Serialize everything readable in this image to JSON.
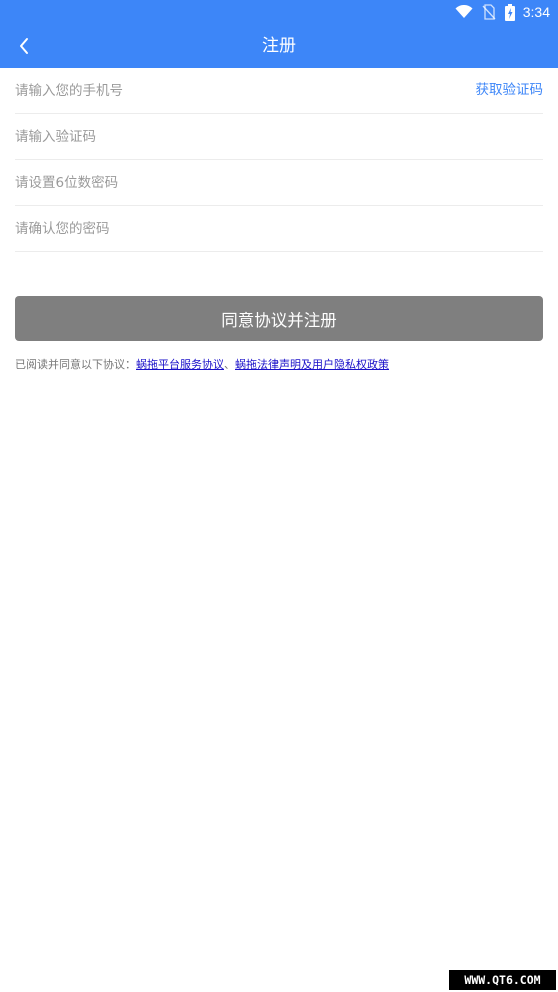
{
  "status_bar": {
    "time": "3:34",
    "icons": [
      "wifi-icon",
      "no-sim-icon",
      "battery-charging-icon"
    ]
  },
  "app_bar": {
    "back_icon": "chevron-left-icon",
    "title": "注册"
  },
  "form": {
    "phone_placeholder": "请输入您的手机号",
    "get_code_label": "获取验证码",
    "code_placeholder": "请输入验证码",
    "password_placeholder": "请设置6位数密码",
    "confirm_placeholder": "请确认您的密码"
  },
  "submit": {
    "label": "同意协议并注册"
  },
  "agreement": {
    "prefix": "已阅读并同意以下协议：",
    "link1": "蜗拖平台服务协议",
    "separator": "、",
    "link2": "蜗拖法律声明及用户隐私权政策"
  },
  "watermark": {
    "text": "WWW.QT6.COM"
  },
  "colors": {
    "primary": "#3d86f8",
    "button_disabled": "#7f7f7f",
    "link": "#1a10c9"
  }
}
